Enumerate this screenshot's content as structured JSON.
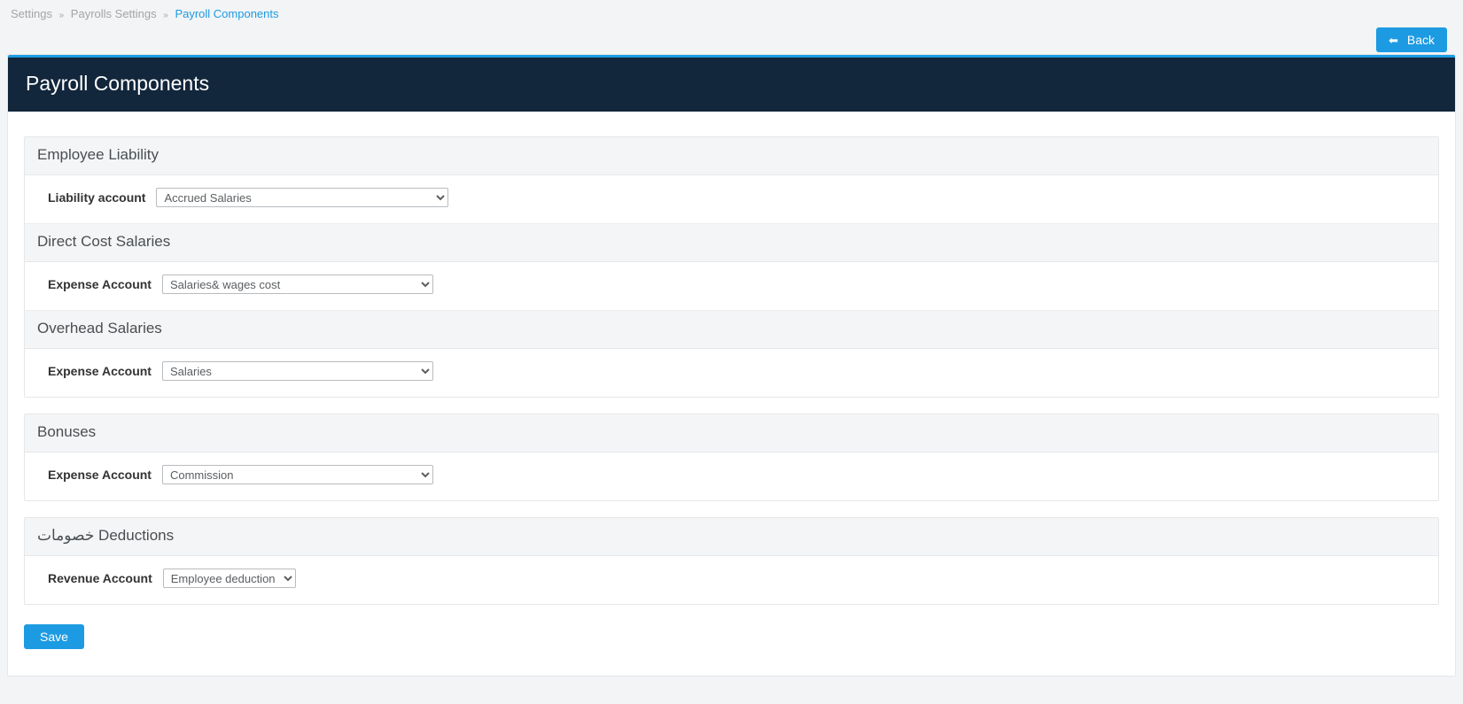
{
  "breadcrumb": {
    "settings": "Settings",
    "payroll_settings": "Payrolls Settings",
    "payroll_components": "Payroll Components"
  },
  "back_button": "Back",
  "page_title": "Payroll Components",
  "sections": {
    "employee_liability": {
      "title": "Employee Liability",
      "field_label": "Liability account",
      "value": "Accrued Salaries"
    },
    "direct_cost_salaries": {
      "title": "Direct Cost Salaries",
      "field_label": "Expense Account",
      "value": "Salaries& wages cost"
    },
    "overhead_salaries": {
      "title": "Overhead Salaries",
      "field_label": "Expense Account",
      "value": "Salaries"
    },
    "bonuses": {
      "title": "Bonuses",
      "field_label": "Expense Account",
      "value": "Commission"
    },
    "deductions": {
      "title": "خصومات  Deductions",
      "field_label": "Revenue Account",
      "value": "Employee deduction"
    }
  },
  "save_button": "Save"
}
